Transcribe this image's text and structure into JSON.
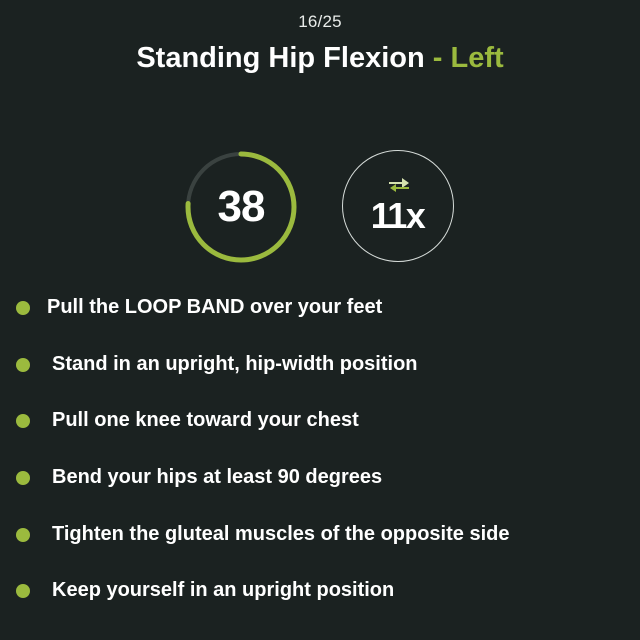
{
  "header": {
    "counter": "16/25",
    "exercise_name": "Standing Hip Flexion",
    "separator": "-",
    "side": "Left"
  },
  "timer": {
    "value": "38",
    "progress": 0.76
  },
  "reps": {
    "icon": "swap-arrows-icon",
    "value": "11x"
  },
  "instructions": [
    "Pull the LOOP BAND over your feet",
    "Stand in an upright, hip-width position",
    "Pull one knee toward your chest",
    "Bend your hips at least 90 degrees",
    "Tighten the gluteal muscles of the opposite side",
    "Keep yourself in an upright position"
  ],
  "colors": {
    "background": "#1b2221",
    "accent": "#9bba3e",
    "track": "#3a4240",
    "text": "#ffffff"
  }
}
